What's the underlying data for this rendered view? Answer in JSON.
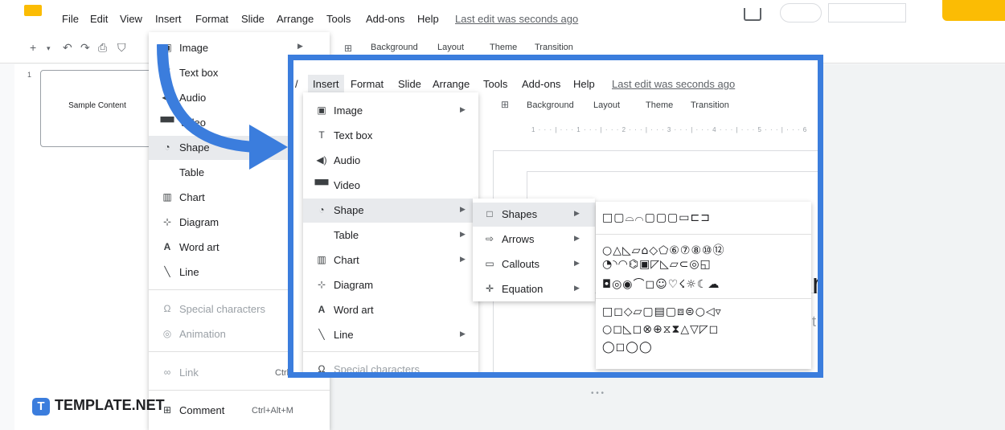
{
  "menubar": {
    "items": [
      "File",
      "Edit",
      "View",
      "Insert",
      "Format",
      "Slide",
      "Arrange",
      "Tools",
      "Add-ons",
      "Help"
    ],
    "last_edit": "Last edit was seconds ago"
  },
  "toolbar": {
    "icons": [
      "add-icon",
      "undo-icon",
      "redo-icon",
      "print-icon",
      "paint-format-icon"
    ],
    "items": [
      "Background",
      "Layout",
      "Theme",
      "Transition"
    ]
  },
  "slide_panel": {
    "slide_number": "1",
    "thumb_text": "Sample Content"
  },
  "insert_menu": {
    "items": [
      {
        "icon": "image-icon",
        "label": "Image",
        "arrow": true
      },
      {
        "icon": "text-box-icon",
        "label": "Text box"
      },
      {
        "icon": "audio-icon",
        "label": "Audio"
      },
      {
        "icon": "video-icon",
        "label": "Video"
      },
      {
        "icon": "shape-icon",
        "label": "Shape"
      },
      {
        "icon": "",
        "label": "Table"
      },
      {
        "icon": "chart-icon",
        "label": "Chart"
      },
      {
        "icon": "diagram-icon",
        "label": "Diagram"
      },
      {
        "icon": "word-art-icon",
        "label": "Word art"
      },
      {
        "icon": "line-icon",
        "label": "Line"
      },
      {
        "icon": "omega-icon",
        "label": "Special characters"
      },
      {
        "icon": "animation-icon",
        "label": "Animation"
      },
      {
        "icon": "link-icon",
        "label": "Link",
        "shortcut": "Ctrl+K"
      },
      {
        "icon": "comment-icon",
        "label": "Comment",
        "shortcut": "Ctrl+Alt+M"
      }
    ]
  },
  "zoom": {
    "menubar": [
      "Insert",
      "Format",
      "Slide",
      "Arrange",
      "Tools",
      "Add-ons",
      "Help"
    ],
    "last_edit": "Last edit was seconds ago",
    "toolbar": [
      "Background",
      "Layout",
      "Theme",
      "Transition"
    ],
    "ruler": "1 · · · | · · · 1 · · · | · · · 2 · · · | · · · 3 · · · | · · · 4 · · · | · · · 5 · · · | · · · 6",
    "menu": [
      {
        "label": "Image",
        "arrow": true
      },
      {
        "label": "Text box"
      },
      {
        "label": "Audio"
      },
      {
        "label": "Video"
      },
      {
        "label": "Shape",
        "arrow": true
      },
      {
        "label": "Table",
        "arrow": true
      },
      {
        "label": "Chart",
        "arrow": true
      },
      {
        "label": "Diagram"
      },
      {
        "label": "Word art"
      },
      {
        "label": "Line",
        "arrow": true
      },
      {
        "label": "Special characters"
      }
    ],
    "shape_sub": [
      "Shapes",
      "Arrows",
      "Callouts",
      "Equation"
    ],
    "glyph_rows": [
      "□▢⌓⌒▢▢▢▭⊏⊐",
      "○△◺▱⌂◇⬠⑥⑦⑧⑩⑫",
      "◔◝◠⌬▣◸◺⏥⊂◎◱",
      "◘◎◉⌒◻☺♡☇☼☾☁",
      "□◻◇▱▢▤▢⧈⊜○◁▿",
      "○◻◺◻⊗⊕⧖⧗△▽◸◻",
      "◯◻◯◯"
    ],
    "crop_m": "m",
    "crop_t": "t"
  },
  "logo": {
    "letter": "T",
    "text": "TEMPLATE.NET"
  }
}
